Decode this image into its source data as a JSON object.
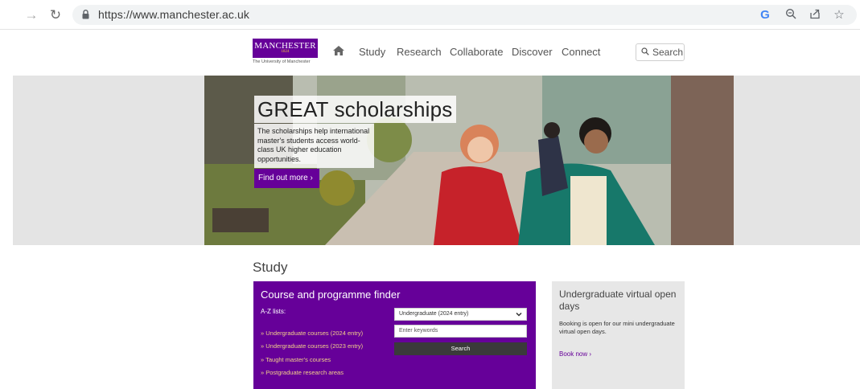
{
  "browser": {
    "url": "https://www.manchester.ac.uk",
    "icons": [
      "back-arrow-icon",
      "reload-icon",
      "lock-icon",
      "google-icon",
      "zoom-icon",
      "share-icon",
      "bookmark-star-icon"
    ]
  },
  "site": {
    "logo": {
      "name": "MANCHESTER",
      "year": "1824",
      "sub": "The University of Manchester"
    },
    "nav": [
      "Study",
      "Research",
      "Collaborate",
      "Discover",
      "Connect"
    ],
    "search_label": "Search",
    "brand_color": "#660099"
  },
  "hero": {
    "title": "GREAT scholarships",
    "text": "The scholarships help international master's students access world-class UK higher education opportunities.",
    "cta": "Find out more ›"
  },
  "study": {
    "heading": "Study",
    "finder": {
      "title": "Course and programme finder",
      "az_label": "A-Z lists:",
      "links": [
        "» Undergraduate courses (2024 entry)",
        "» Undergraduate courses (2023 entry)",
        "» Taught master's courses",
        "» Postgraduate research areas"
      ],
      "level_selected": "Undergraduate (2024 entry)",
      "keyword_placeholder": "Enter keywords",
      "search_button": "Search"
    },
    "open_days": {
      "title": "Undergraduate virtual open days",
      "text": "Booking is open for our mini undergraduate virtual open days.",
      "link": "Book now ›"
    }
  }
}
